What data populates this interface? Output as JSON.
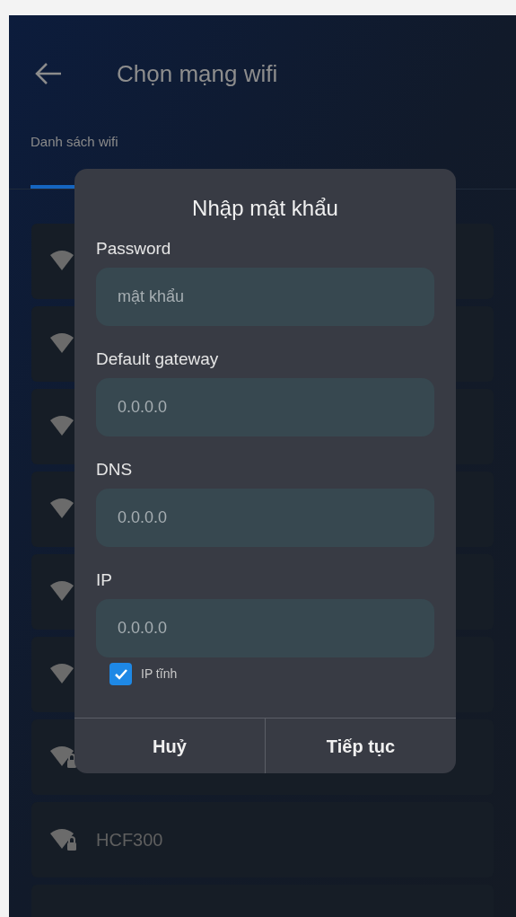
{
  "header": {
    "title": "Chọn mạng wifi"
  },
  "tabs": [
    {
      "label": "Danh sách wifi",
      "selected": true
    }
  ],
  "wifi_list": [
    {
      "kind": "network",
      "locked": false
    },
    {
      "kind": "network",
      "locked": false
    },
    {
      "kind": "network",
      "locked": false
    },
    {
      "kind": "network",
      "locked": false
    },
    {
      "kind": "network",
      "locked": false
    },
    {
      "kind": "network",
      "locked": false
    },
    {
      "kind": "network",
      "locked": true
    },
    {
      "kind": "network",
      "locked": true,
      "name": "HCF300"
    },
    {
      "kind": "cut_off"
    }
  ],
  "dialog": {
    "title": "Nhập mật khẩu",
    "fields": [
      {
        "label": "Password",
        "placeholder": "mật khẩu"
      },
      {
        "label": "Default gateway",
        "placeholder": "0.0.0.0"
      },
      {
        "label": "DNS",
        "placeholder": "0.0.0.0"
      },
      {
        "label": "IP",
        "placeholder": "0.0.0.0"
      }
    ],
    "static_ip": {
      "label": "IP tĩnh",
      "checked": true
    },
    "buttons": [
      "Huỷ",
      "Tiếp tục"
    ]
  }
}
